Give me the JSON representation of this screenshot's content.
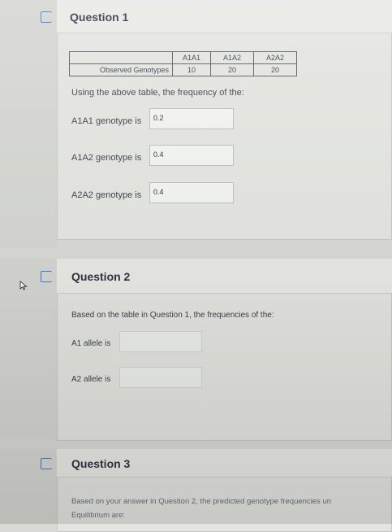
{
  "questions": [
    {
      "title": "Question 1",
      "table": {
        "headers": [
          "",
          "A1A1",
          "A1A2",
          "A2A2"
        ],
        "row_label": "Observed Genotypes",
        "values": [
          "10",
          "20",
          "20"
        ]
      },
      "prompt": "Using the above table, the frequency of the:",
      "fields": [
        {
          "label": "A1A1 genotype is",
          "value": "0.2"
        },
        {
          "label": "A1A2 genotype is",
          "value": "0.4"
        },
        {
          "label": "A2A2 genotype is",
          "value": "0.4"
        }
      ]
    },
    {
      "title": "Question 2",
      "prompt": "Based on the table in Question 1, the frequencies of the:",
      "fields": [
        {
          "label": "A1 allele is",
          "value": ""
        },
        {
          "label": "A2 allele is",
          "value": ""
        }
      ]
    },
    {
      "title": "Question 3",
      "prompt_line1": "Based on your answer in Question 2, the predicted genotype frequencies un",
      "prompt_line2": "Equilibrium are:"
    }
  ],
  "colors": {
    "flag": "#3a7bd5",
    "page": "#d9dad6",
    "card": "#e4e5e1"
  }
}
